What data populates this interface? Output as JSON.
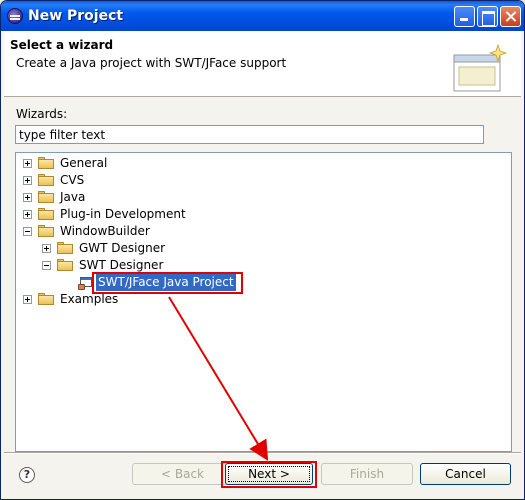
{
  "window": {
    "title": "New Project",
    "accent_color": "#0058ee"
  },
  "header": {
    "title": "Select a wizard",
    "description": "Create a Java project with SWT/JFace support"
  },
  "wizards": {
    "label": "Wizards:",
    "filter_value": "type filter text",
    "filter_placeholder": "type filter text"
  },
  "tree": {
    "nodes": [
      {
        "label": "General",
        "expanded": false,
        "level": 0
      },
      {
        "label": "CVS",
        "expanded": false,
        "level": 0
      },
      {
        "label": "Java",
        "expanded": false,
        "level": 0
      },
      {
        "label": "Plug-in Development",
        "expanded": false,
        "level": 0
      },
      {
        "label": "WindowBuilder",
        "expanded": true,
        "level": 0
      },
      {
        "label": "GWT Designer",
        "expanded": false,
        "level": 1
      },
      {
        "label": "SWT Designer",
        "expanded": true,
        "level": 1
      },
      {
        "label": "SWT/JFace Java Project",
        "selected": true,
        "level": 2
      },
      {
        "label": "Examples",
        "expanded": false,
        "level": 0
      }
    ]
  },
  "buttons": {
    "help": "?",
    "back": "< Back",
    "next": "Next >",
    "finish": "Finish",
    "cancel": "Cancel"
  },
  "annotation": {
    "highlight_color": "#e00000"
  }
}
